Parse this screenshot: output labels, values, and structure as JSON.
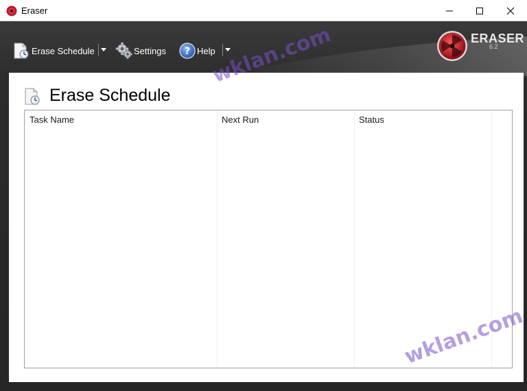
{
  "window": {
    "title": "Eraser",
    "controls": {
      "minimize": "—",
      "maximize": "☐",
      "close": "✕"
    }
  },
  "toolbar": {
    "items": [
      {
        "label": "Erase Schedule",
        "icon": "clock-document-icon",
        "has_dropdown": true
      },
      {
        "label": "Settings",
        "icon": "gears-icon",
        "has_dropdown": false
      },
      {
        "label": "Help",
        "icon": "help-icon",
        "has_dropdown": true
      }
    ]
  },
  "brand": {
    "name": "ERASER",
    "version": "6.2"
  },
  "page": {
    "title": "Erase Schedule"
  },
  "task_list": {
    "columns": [
      "Task Name",
      "Next Run",
      "Status"
    ],
    "rows": []
  },
  "watermark": {
    "text": "wklan.com"
  },
  "colors": {
    "toolbar_bg": "#2b2b2b",
    "panel_bg": "#ffffff",
    "logo_red": "#c8102e",
    "watermark": "#7850c8"
  }
}
